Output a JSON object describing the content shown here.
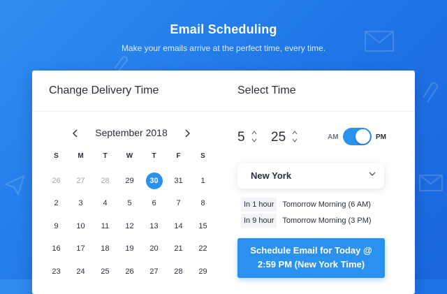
{
  "hero": {
    "title": "Email Scheduling",
    "subtitle": "Make your emails arrive at the perfect time, every time."
  },
  "left_panel": {
    "title": "Change Delivery Time",
    "calendar": {
      "month_label": "September 2018",
      "weekdays": [
        "S",
        "M",
        "T",
        "W",
        "T",
        "F",
        "S"
      ],
      "days": [
        {
          "n": "26",
          "muted": true
        },
        {
          "n": "27",
          "muted": true
        },
        {
          "n": "28",
          "muted": true
        },
        {
          "n": "29"
        },
        {
          "n": "30",
          "selected": true
        },
        {
          "n": "31"
        },
        {
          "n": "1"
        },
        {
          "n": "2"
        },
        {
          "n": "3"
        },
        {
          "n": "4"
        },
        {
          "n": "5"
        },
        {
          "n": "6"
        },
        {
          "n": "7"
        },
        {
          "n": "8"
        },
        {
          "n": "9"
        },
        {
          "n": "10"
        },
        {
          "n": "11"
        },
        {
          "n": "12"
        },
        {
          "n": "13"
        },
        {
          "n": "14"
        },
        {
          "n": "15"
        },
        {
          "n": "16"
        },
        {
          "n": "17"
        },
        {
          "n": "18"
        },
        {
          "n": "19"
        },
        {
          "n": "20"
        },
        {
          "n": "21"
        },
        {
          "n": "22"
        },
        {
          "n": "23"
        },
        {
          "n": "24"
        },
        {
          "n": "25"
        },
        {
          "n": "26"
        },
        {
          "n": "27"
        },
        {
          "n": "28"
        },
        {
          "n": "29"
        }
      ]
    }
  },
  "right_panel": {
    "title": "Select Time",
    "hour": "5",
    "minute": "25",
    "am_label": "AM",
    "pm_label": "PM",
    "period_selected": "PM",
    "timezone": "New York",
    "quick_options": [
      {
        "pill": "In 1 hour",
        "text": "Tomorrow Morning (6 AM)"
      },
      {
        "pill": "In 9 hour",
        "text": "Tomorrow Morning (3 PM)"
      }
    ],
    "cta_line1": "Schedule Email for Today @",
    "cta_line2": "2:59 PM (New York Time)"
  },
  "colors": {
    "accent": "#2b91ee",
    "background_start": "#2f8df0",
    "background_end": "#1a66dc"
  },
  "icons": {
    "prev": "chevron-left-icon",
    "next": "chevron-right-icon",
    "dropdown": "chevron-down-icon",
    "deco_envelope": "envelope-icon"
  }
}
